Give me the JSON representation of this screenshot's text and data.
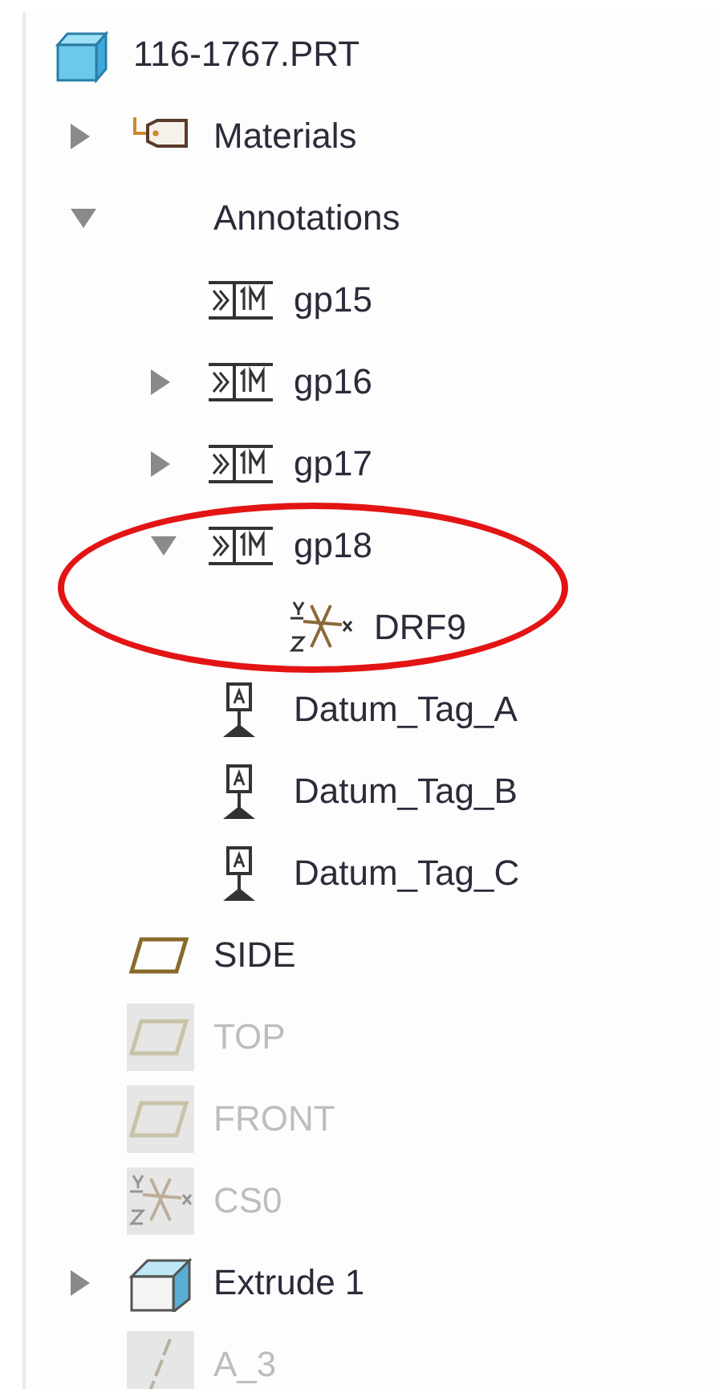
{
  "tree": {
    "label": "116-1767.PRT",
    "kind": "part",
    "children": [
      {
        "label": "Materials",
        "kind": "material",
        "expanded": false
      },
      {
        "label": "Annotations",
        "kind": "group",
        "expanded": true,
        "children": [
          {
            "label": "gp15",
            "kind": "annotation"
          },
          {
            "label": "gp16",
            "kind": "annotation",
            "expanded": false
          },
          {
            "label": "gp17",
            "kind": "annotation",
            "expanded": false
          },
          {
            "label": "gp18",
            "kind": "annotation",
            "expanded": true,
            "highlighted": true,
            "children": [
              {
                "label": "DRF9",
                "kind": "csys"
              }
            ]
          },
          {
            "label": "Datum_Tag_A",
            "kind": "datum_tag"
          },
          {
            "label": "Datum_Tag_B",
            "kind": "datum_tag"
          },
          {
            "label": "Datum_Tag_C",
            "kind": "datum_tag"
          }
        ]
      },
      {
        "label": "SIDE",
        "kind": "plane"
      },
      {
        "label": "TOP",
        "kind": "plane",
        "hidden": true
      },
      {
        "label": "FRONT",
        "kind": "plane",
        "hidden": true
      },
      {
        "label": "CS0",
        "kind": "csys",
        "hidden": true
      },
      {
        "label": "Extrude 1",
        "kind": "extrude",
        "expanded": false
      },
      {
        "label": "A_3",
        "kind": "axis",
        "hidden": true
      }
    ]
  }
}
